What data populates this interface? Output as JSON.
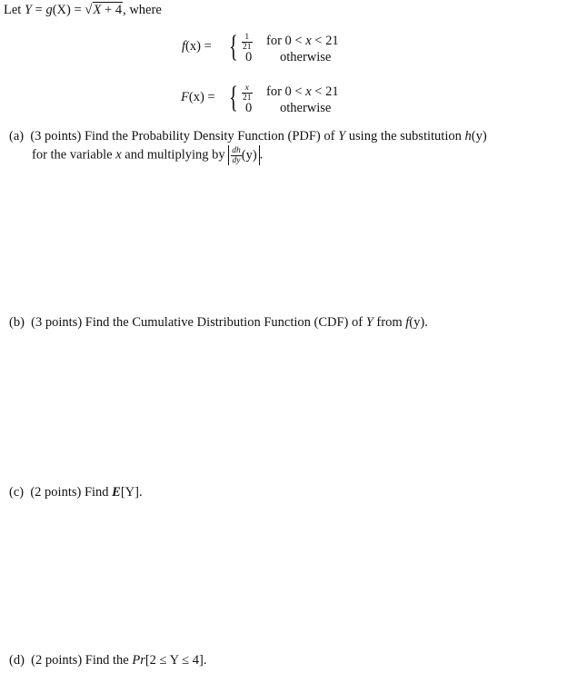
{
  "intro": {
    "prefix": "Let ",
    "Y": "Y",
    "eq1": " = ",
    "g": "g",
    "X": "(X)",
    "eq2": " = ",
    "radical": "√",
    "radicand_X": "X",
    "radicand_rest": " + 4",
    "suffix": ", where"
  },
  "pdf": {
    "lhs_f": "f",
    "lhs_arg": "(x)",
    "lhs_eq": " =",
    "case1_num": "1",
    "case1_den": "21",
    "case1_cond_for": "for 0 < ",
    "case1_cond_x": "x",
    "case1_cond_end": " < 21",
    "case2_val": "0",
    "case2_cond": "otherwise"
  },
  "cdf": {
    "lhs_F": "F",
    "lhs_arg": "(x)",
    "lhs_eq": " =",
    "case1_num": "x",
    "case1_den": "21",
    "case1_cond_for": "for 0 < ",
    "case1_cond_x": "x",
    "case1_cond_end": " < 21",
    "case2_val": "0",
    "case2_cond": "otherwise"
  },
  "questions": {
    "a": {
      "label": "(a)",
      "points": "(3 points)",
      "line1_text": "Find the Probability Density Function (PDF) of ",
      "line1_Y": "Y",
      "line1_rest": " using the substitution ",
      "line1_h": "h",
      "line1_hy": "(y)",
      "line2_text": "for the variable ",
      "line2_x": "x",
      "line2_rest": " and multiplying by ",
      "deriv_num": "dh",
      "deriv_den": "dy",
      "deriv_arg": "(y)",
      "line2_end": "."
    },
    "b": {
      "label": "(b)",
      "points": "(3 points)",
      "text": "Find the Cumulative Distribution Function (CDF) of ",
      "Y": "Y",
      "mid": " from ",
      "f": "f",
      "fy": "(y)",
      "end": "."
    },
    "c": {
      "label": "(c)",
      "points": "(2 points)",
      "text": "Find ",
      "E": "E",
      "arg": "[Y]",
      "end": "."
    },
    "d": {
      "label": "(d)",
      "points": "(2 points)",
      "text": "Find the ",
      "Pr": "Pr",
      "expr": "[2 ≤ Y ≤ 4]",
      "end": "."
    }
  }
}
